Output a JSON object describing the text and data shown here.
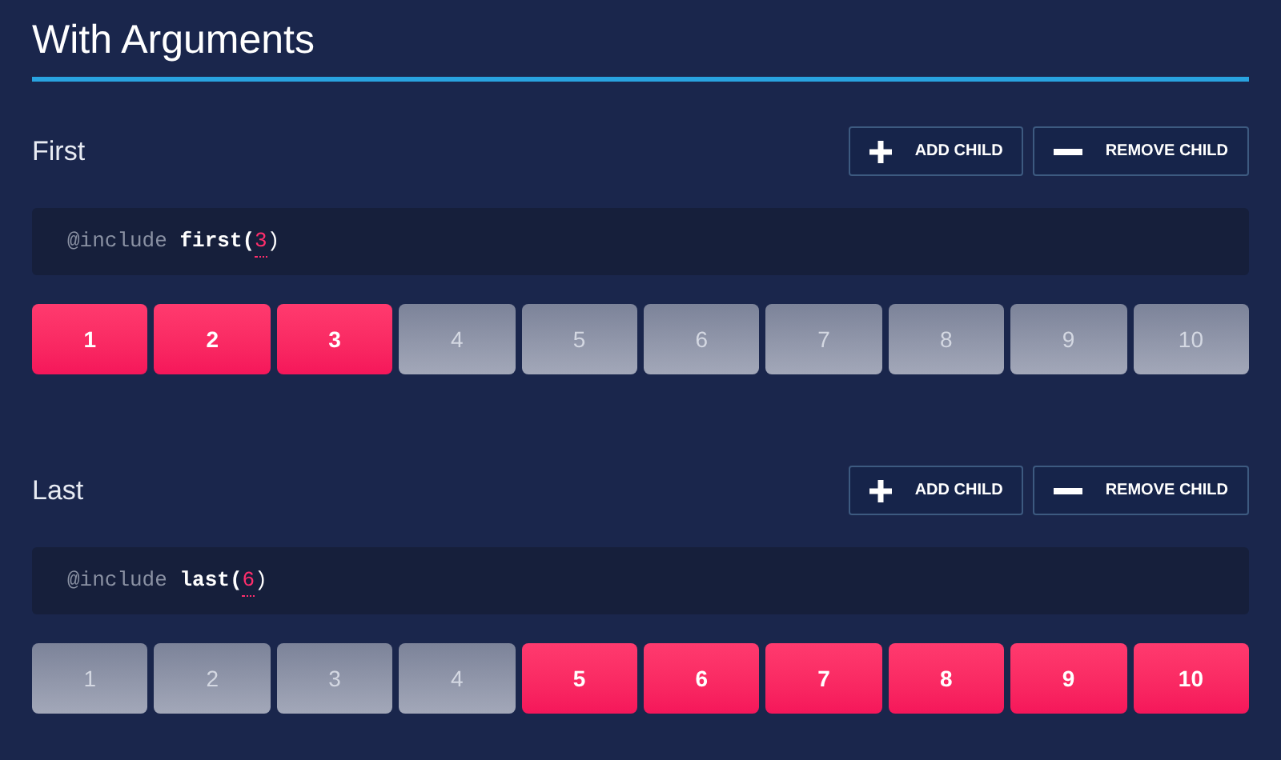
{
  "title": "With Arguments",
  "sections": [
    {
      "heading": "First",
      "buttons": [
        {
          "kind": "add",
          "label": "ADD CHILD"
        },
        {
          "kind": "remove",
          "label": "REMOVE CHILD"
        }
      ],
      "code": {
        "keyword": "@include",
        "function": "first(",
        "argument": "3",
        "closing": ")"
      },
      "items": [
        {
          "label": "1",
          "selected": true
        },
        {
          "label": "2",
          "selected": true
        },
        {
          "label": "3",
          "selected": true
        },
        {
          "label": "4",
          "selected": false
        },
        {
          "label": "5",
          "selected": false
        },
        {
          "label": "6",
          "selected": false
        },
        {
          "label": "7",
          "selected": false
        },
        {
          "label": "8",
          "selected": false
        },
        {
          "label": "9",
          "selected": false
        },
        {
          "label": "10",
          "selected": false
        }
      ]
    },
    {
      "heading": "Last",
      "buttons": [
        {
          "kind": "add",
          "label": "ADD CHILD"
        },
        {
          "kind": "remove",
          "label": "REMOVE CHILD"
        }
      ],
      "code": {
        "keyword": "@include",
        "function": "last(",
        "argument": "6",
        "closing": ")"
      },
      "items": [
        {
          "label": "1",
          "selected": false
        },
        {
          "label": "2",
          "selected": false
        },
        {
          "label": "3",
          "selected": false
        },
        {
          "label": "4",
          "selected": false
        },
        {
          "label": "5",
          "selected": true
        },
        {
          "label": "6",
          "selected": true
        },
        {
          "label": "7",
          "selected": true
        },
        {
          "label": "8",
          "selected": true
        },
        {
          "label": "9",
          "selected": true
        },
        {
          "label": "10",
          "selected": true
        }
      ]
    }
  ]
}
